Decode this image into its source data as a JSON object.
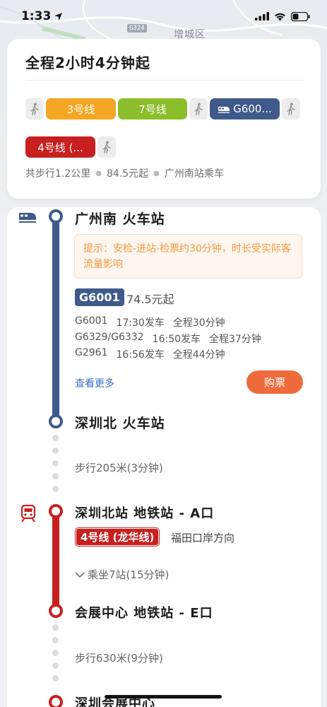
{
  "status_bar": {
    "time": "1:33"
  },
  "map": {
    "district_label": "增城区",
    "road_label": "G324"
  },
  "summary": {
    "title": "全程2小时4分钟起",
    "chips": [
      {
        "label": "3号线",
        "color": "#f5a623"
      },
      {
        "label": "7号线",
        "color": "#8cbd2b"
      },
      {
        "label": "G600...",
        "color": "#3f5a8a"
      },
      {
        "label": "4号线 (...",
        "color": "#c81f1f"
      }
    ],
    "walk_distance": "共步行1.2公里",
    "price": "84.5元起",
    "boarding": "广州南站乘车"
  },
  "segments": {
    "origin_station": "广州南 火车站",
    "tip": "提示：安检-进站-检票约30分钟，时长受实际客流量影响",
    "train_badge": "G6001",
    "train_price": "74.5元起",
    "trains": [
      {
        "number": "G6001",
        "depart": "17:30发车",
        "duration": "全程30分钟"
      },
      {
        "number": "G6329/G6332",
        "depart": "16:50发车",
        "duration": "全程37分钟"
      },
      {
        "number": "G2961",
        "depart": "16:56发车",
        "duration": "全程44分钟"
      }
    ],
    "more_label": "查看更多",
    "buy_label": "购票",
    "arrival_station": "深圳北 火车站",
    "walk_1": "步行205米(3分钟)",
    "metro_station": "深圳北站 地铁站 - A口",
    "metro_line": "4号线 (龙华线)",
    "metro_direction": "福田口岸方向",
    "ride_info": "乘坐7站(15分钟)",
    "metro_exit_station": "会展中心 地铁站 - E口",
    "walk_2": "步行630米(9分钟)",
    "destination": "深圳会展中心"
  }
}
